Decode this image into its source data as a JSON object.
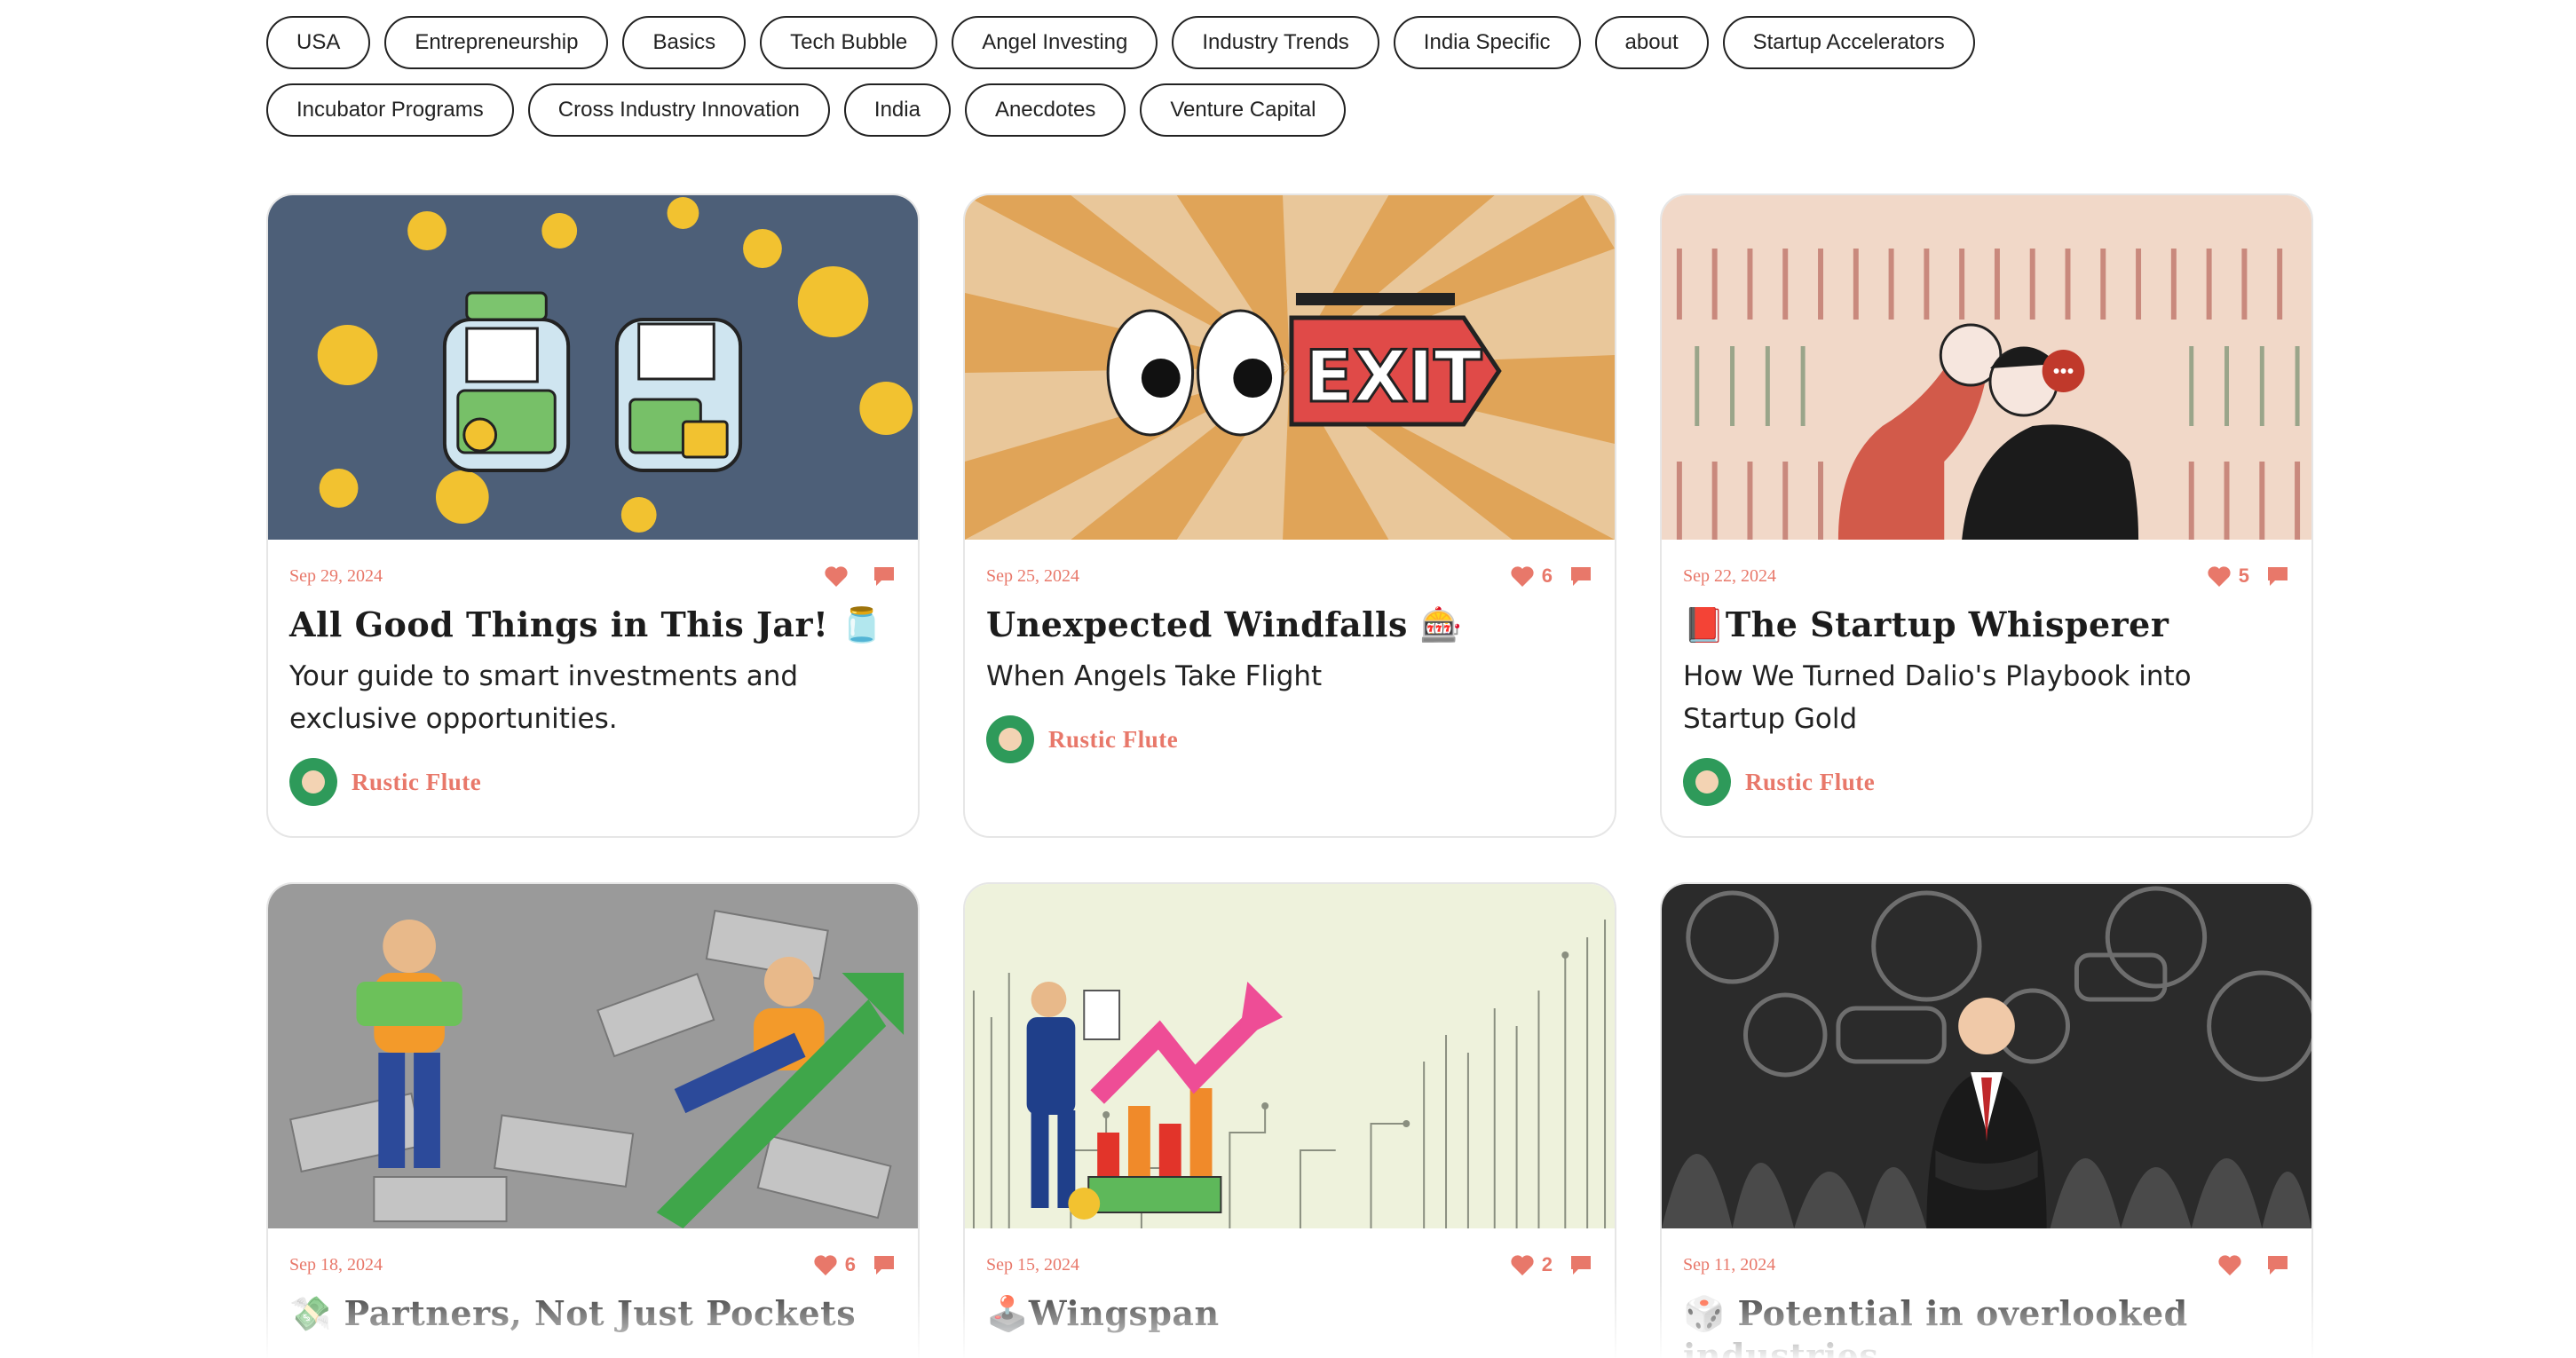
{
  "tags_row1": [
    "USA",
    "Entrepreneurship",
    "Basics",
    "Tech Bubble",
    "Angel Investing",
    "Industry Trends",
    "India Specific",
    "about",
    "Startup Accelerators"
  ],
  "tags_row2": [
    "Incubator Programs",
    "Cross Industry Innovation",
    "India",
    "Anecdotes",
    "Venture Capital"
  ],
  "posts": [
    {
      "date": "Sep 29, 2024",
      "likes": "",
      "title": "All Good Things in This Jar! 🫙",
      "subtitle": "Your guide to smart investments and exclusive opportunities.",
      "author": "Rustic Flute",
      "image": "jars-of-coins-illustration"
    },
    {
      "date": "Sep 25, 2024",
      "likes": "6",
      "title": "Unexpected Windfalls 🎰",
      "subtitle": "When Angels Take Flight",
      "author": "Rustic Flute",
      "image": "eyes-exit-sign-illustration"
    },
    {
      "date": "Sep 22, 2024",
      "likes": "5",
      "title": "📕The Startup Whisperer",
      "subtitle": "How We Turned Dalio's Playbook into Startup Gold",
      "author": "Rustic Flute",
      "image": "whispering-couple-illustration"
    },
    {
      "date": "Sep 18, 2024",
      "likes": "6",
      "title": "💸 Partners, Not Just Pockets",
      "subtitle": "",
      "author": "",
      "image": "money-pile-growth-illustration"
    },
    {
      "date": "Sep 15, 2024",
      "likes": "2",
      "title": "🕹️Wingspan",
      "subtitle": "",
      "author": "",
      "image": "circuit-chart-businessman-illustration"
    },
    {
      "date": "Sep 11, 2024",
      "likes": "",
      "title": "🎲 Potential in overlooked industries",
      "subtitle": "",
      "author": "",
      "image": "businessman-machinery-illustration"
    }
  ],
  "colors": {
    "accent": "#e8786a",
    "tag_border": "#222222",
    "card_border": "#e6e6e6"
  },
  "icons": {
    "like": "heart-icon",
    "comment": "comment-icon"
  }
}
